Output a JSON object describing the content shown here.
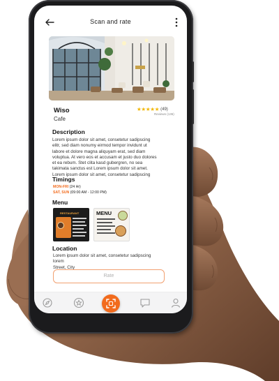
{
  "header": {
    "title": "Scan and rate",
    "back_icon": "arrow-left-icon",
    "menu_icon": "more-vertical-icon"
  },
  "cafe": {
    "name": "Wiso",
    "type": "Cafe",
    "stars": "★★★★★",
    "rating_count": "(49)",
    "reviews_label": "Reviews (136)"
  },
  "description": {
    "title": "Description",
    "lines": [
      "Lorem ipsum dolor sit amet, consetetur sadipscing",
      "elitr, sed diam nonumy eirmod tempor invidunt ut",
      "labore et dolore magna aliquyam erat, sed diam",
      "voluptua. At vero eos et accusam et justo duo dolores",
      "et ea rebum. Stet clita kasd gubergren, no sea",
      "takimata sanctus est Lorem ipsum dolor sit amet.",
      "Lorem ipsum dolor sit amet, consetetur sadipscing"
    ]
  },
  "timings": {
    "title": "Timings",
    "rows": [
      {
        "days": "MON-FRI",
        "hours": " (24 Hr)"
      },
      {
        "days": "SAT, SUN",
        "hours": " (09:00 AM - 12:00 PM)"
      }
    ]
  },
  "menu": {
    "title": "Menu",
    "card_heading": "MENU",
    "card_small_heading": "RESTAURANT"
  },
  "location": {
    "title": "Location",
    "lines": [
      "Lorem ipsum dolor sit amet, consetetur sadipscing lorem",
      "Street, City"
    ]
  },
  "rate_button": "Rate",
  "nav": {
    "items": [
      "compass-icon",
      "star-icon",
      "scan-icon",
      "chat-icon",
      "user-icon"
    ],
    "accent": "#f26b1d"
  },
  "colors": {
    "accent": "#f26b1d",
    "star": "#f2b705",
    "phone_body": "#1b1b1d"
  }
}
